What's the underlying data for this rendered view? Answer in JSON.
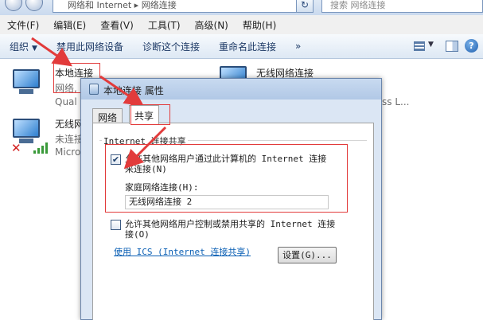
{
  "address_bar": {
    "path": "网络和 Internet ▸ 网络连接",
    "search_placeholder": "搜索 网络连接"
  },
  "menu": [
    "文件(F)",
    "编辑(E)",
    "查看(V)",
    "工具(T)",
    "高级(N)",
    "帮助(H)"
  ],
  "toolbar": {
    "organize": "组织",
    "disable": "禁用此网络设备",
    "diagnose": "诊断这个连接",
    "rename": "重命名此连接",
    "more": "»"
  },
  "connections": {
    "local": {
      "name": "本地连接",
      "status": "网络,",
      "device": "Qual"
    },
    "wireless_left": {
      "name": "无线网",
      "status": "未连接",
      "device": "Micro"
    },
    "wireless_right": {
      "name": "无线网络连接",
      "device": "ss L..."
    }
  },
  "dialog": {
    "title": "本地连接 属性",
    "tabs": [
      "网络",
      "共享"
    ],
    "group_label": "Internet 连接共享",
    "allow_share_line1": "允许其他网络用户通过此计算机的 Internet 连接",
    "allow_share_line2": "来连接(N)",
    "allow_share_checked": true,
    "home_network_label": "家庭网络连接(H):",
    "home_network_value": "无线网络连接 2",
    "allow_control_line1": "允许其他网络用户控制或禁用共享的 Internet 连接",
    "allow_control_line2": "接(O)",
    "allow_control_checked": false,
    "ics_link": "使用 ICS (Internet 连接共享)",
    "settings_button": "设置(G)..."
  },
  "colors": {
    "annotation": "#e23b3b",
    "link": "#0a5fb4"
  }
}
